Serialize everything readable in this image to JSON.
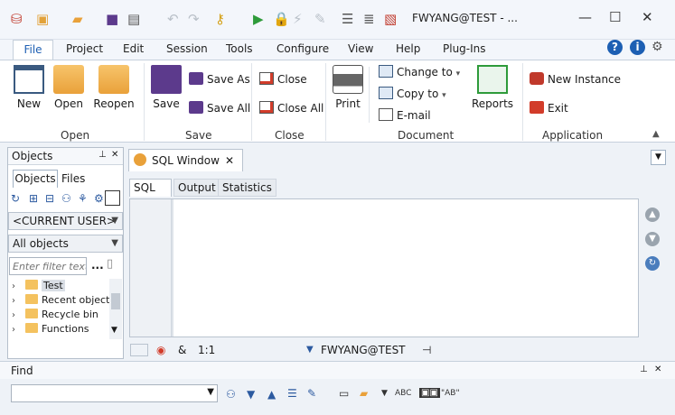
{
  "window": {
    "title": "FWYANG@TEST - ...",
    "controls": {
      "minimize": "—",
      "maximize": "☐",
      "close": "✕"
    }
  },
  "quick_access": {
    "icons": [
      "app-icon",
      "new-icon",
      "open-icon",
      "save-icon",
      "print-icon",
      "undo-icon",
      "redo-icon",
      "key-icon",
      "execute-icon",
      "lock-icon",
      "break-icon",
      "config-icon",
      "beautify-icon",
      "report-icon"
    ]
  },
  "menu": {
    "items": [
      "File",
      "Project",
      "Edit",
      "Session",
      "Tools",
      "Configure",
      "View",
      "Help",
      "Plug-Ins"
    ],
    "help_icons": [
      "?",
      "i",
      "⚙"
    ]
  },
  "ribbon": {
    "groups": {
      "open": {
        "label": "Open",
        "new": "New",
        "open": "Open",
        "reopen": "Reopen"
      },
      "save": {
        "label": "Save",
        "save": "Save",
        "save_as": "Save As",
        "save_all": "Save All"
      },
      "close": {
        "label": "Close",
        "close": "Close",
        "close_all": "Close All"
      },
      "document": {
        "label": "Document",
        "print": "Print",
        "change_to": "Change to",
        "copy_to": "Copy to",
        "email": "E-mail",
        "reports": "Reports"
      },
      "application": {
        "label": "Application",
        "new_instance": "New Instance",
        "exit": "Exit"
      }
    }
  },
  "objects_panel": {
    "title": "Objects",
    "pin": "📌",
    "close": "✕",
    "tabs": [
      "Objects",
      "Files"
    ],
    "user_select": "<CURRENT USER>",
    "filter_select": "All objects",
    "filter_placeholder": "Enter filter text...",
    "more": "...",
    "tree": [
      "Test",
      "Recent objects",
      "Recycle bin",
      "Functions"
    ]
  },
  "document": {
    "tab_label": "SQL Window",
    "tab_close": "✕",
    "subtabs": [
      "SQL",
      "Output",
      "Statistics"
    ],
    "status": {
      "amp": "&",
      "position": "1:1",
      "connection": "FWYANG@TEST"
    }
  },
  "find": {
    "label": "Find",
    "text_abc": "ABC",
    "text_ab": "\"AB\""
  },
  "colors": {
    "accent": "#1d5fb3",
    "run_green": "#2e9b3a",
    "danger": "#d23c2a"
  }
}
